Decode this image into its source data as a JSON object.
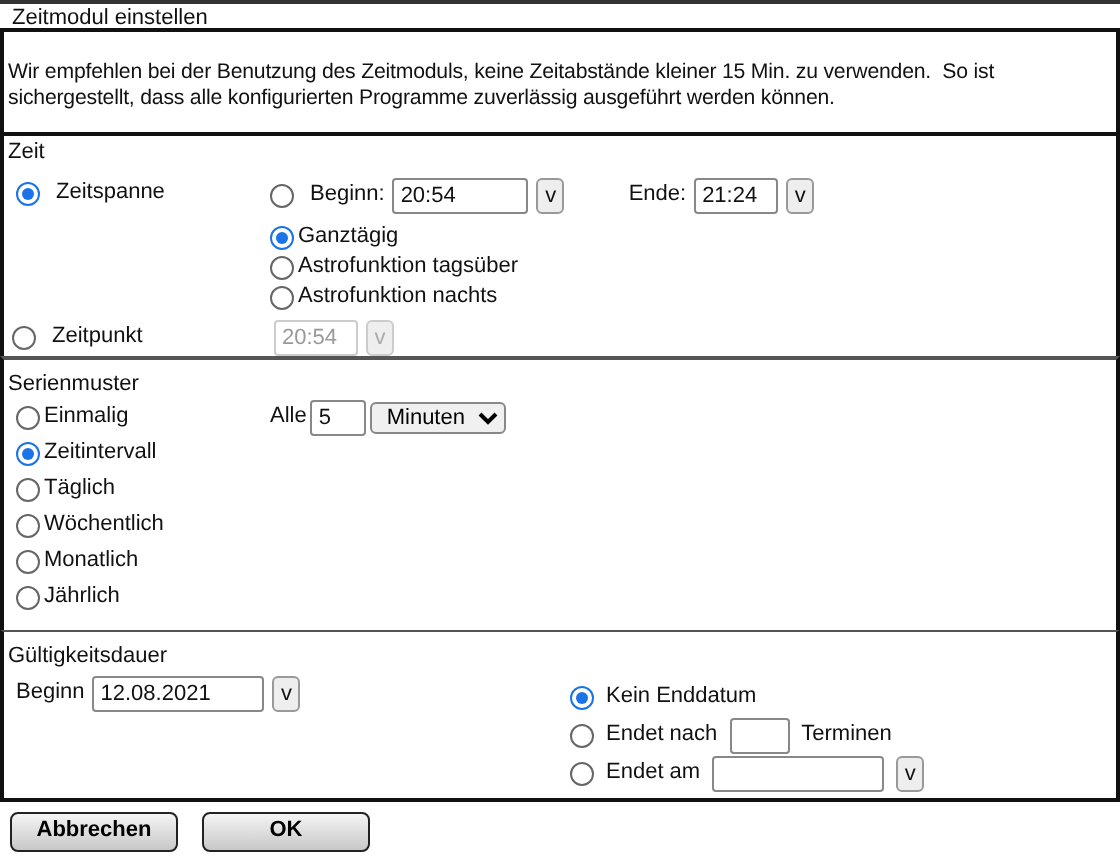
{
  "window": {
    "title": "Zeitmodul einstellen"
  },
  "notice": "Wir empfehlen bei der Benutzung des Zeitmoduls, keine Zeitabstände kleiner 15 Min. zu verwenden.  So ist sichergestellt, dass alle konfigurierten Programme zuverlässig ausgeführt werden können.",
  "zeit": {
    "title": "Zeit",
    "modes": [
      {
        "label": "Zeitspanne",
        "selected": true
      },
      {
        "label": "Zeitpunkt",
        "selected": false
      }
    ],
    "options": [
      {
        "kind": "range",
        "selected": false,
        "begin_label": "Beginn:",
        "begin": "20:54",
        "begin_button": "v",
        "end_label": "Ende:",
        "end": "21:24",
        "end_button": "v"
      },
      {
        "kind": "plain",
        "label": "Ganztägig",
        "selected": true
      },
      {
        "kind": "plain",
        "label": "Astrofunktion tagsüber",
        "selected": false
      },
      {
        "kind": "plain",
        "label": "Astrofunktion nachts",
        "selected": false
      }
    ],
    "point": {
      "value": "20:54",
      "button": "v",
      "disabled": true
    }
  },
  "series": {
    "title": "Serienmuster",
    "patterns": [
      {
        "label": "Einmalig",
        "selected": false
      },
      {
        "label": "Zeitintervall",
        "selected": true
      },
      {
        "label": "Täglich",
        "selected": false
      },
      {
        "label": "Wöchentlich",
        "selected": false
      },
      {
        "label": "Monatlich",
        "selected": false
      },
      {
        "label": "Jährlich",
        "selected": false
      }
    ],
    "every_label": "Alle",
    "every_value": "5",
    "unit": "Minuten"
  },
  "validity": {
    "title": "Gültigkeitsdauer",
    "begin_label": "Beginn",
    "begin": "12.08.2021",
    "begin_button": "v",
    "end_options": [
      {
        "kind": "plain",
        "label": "Kein Enddatum",
        "selected": true
      },
      {
        "kind": "count",
        "label": "Endet nach",
        "suffix": "Terminen",
        "selected": false
      },
      {
        "kind": "date",
        "label": "Endet am",
        "button": "v",
        "selected": false
      }
    ]
  },
  "buttons": [
    "Abbrechen",
    "OK"
  ]
}
